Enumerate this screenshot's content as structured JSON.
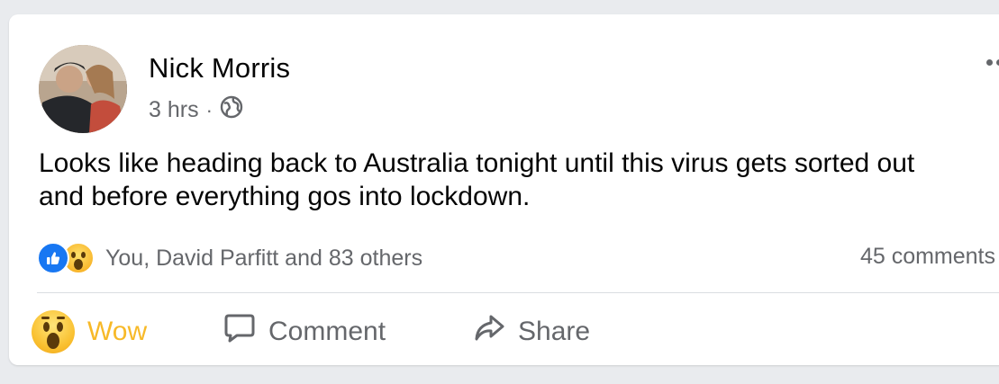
{
  "post": {
    "author": "Nick Morris",
    "time": "3 hrs",
    "separator": "·",
    "privacy_icon": "globe-icon",
    "text": "Looks like heading back to Australia tonight until this virus gets sorted out and before everything gos into lockdown."
  },
  "reactions": {
    "icons": [
      "like-icon",
      "wow-icon"
    ],
    "summary": "You, David Parfitt and 83 others",
    "comments": "45 comments"
  },
  "actions": {
    "wow_label": "Wow",
    "comment_label": "Comment",
    "share_label": "Share"
  },
  "colors": {
    "background": "#e9ebee",
    "card": "#ffffff",
    "secondary_text": "#65676b",
    "like_blue": "#1877f2",
    "wow_yellow": "#f7b928"
  }
}
